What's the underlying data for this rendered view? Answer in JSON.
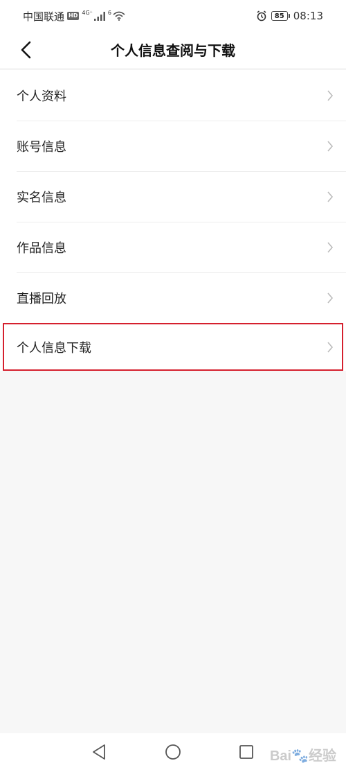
{
  "status_bar": {
    "carrier": "中国联通",
    "hd_badge": "HD",
    "signal_tag": "4G⁺",
    "wifi_tag": "6",
    "battery": "85",
    "time": "08:13"
  },
  "header": {
    "title": "个人信息查阅与下载"
  },
  "menu": {
    "items": [
      {
        "label": "个人资料"
      },
      {
        "label": "账号信息"
      },
      {
        "label": "实名信息"
      },
      {
        "label": "作品信息"
      },
      {
        "label": "直播回放"
      },
      {
        "label": "个人信息下载"
      }
    ]
  },
  "colors": {
    "highlight": "#d5202e",
    "chevron": "#bbbbbb",
    "background": "#f7f7f7"
  }
}
